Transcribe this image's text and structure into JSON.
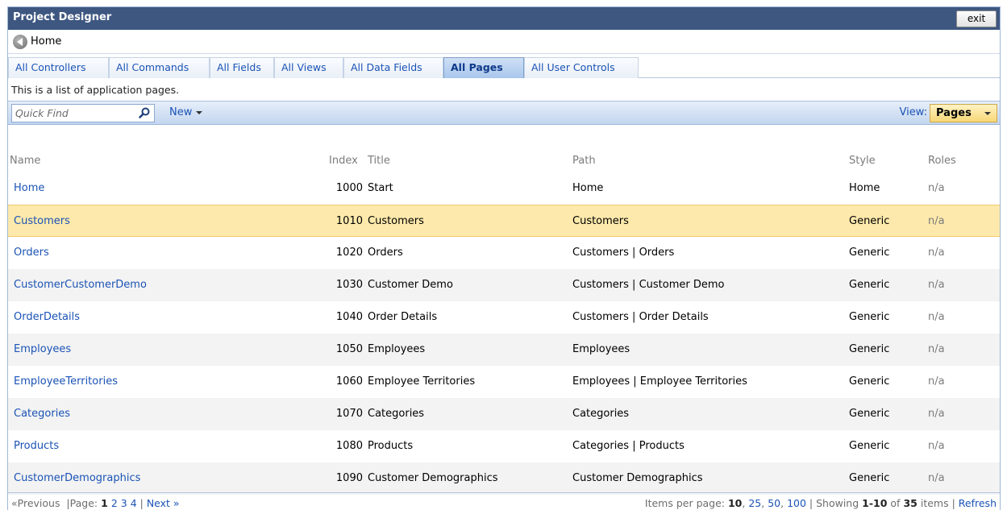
{
  "window": {
    "title": "Project Designer",
    "exit_label": "exit"
  },
  "nav": {
    "home_label": "Home"
  },
  "tabs": [
    {
      "label": "All Controllers"
    },
    {
      "label": "All Commands"
    },
    {
      "label": "All Fields"
    },
    {
      "label": "All Views"
    },
    {
      "label": "All Data Fields"
    },
    {
      "label": "All Pages",
      "active": true
    },
    {
      "label": "All User Controls"
    }
  ],
  "description": "This is a list of application pages.",
  "toolbar": {
    "quick_find_placeholder": "Quick Find",
    "new_label": "New",
    "view_label": "View:",
    "view_value": "Pages"
  },
  "grid": {
    "columns": {
      "name": "Name",
      "index": "Index",
      "title": "Title",
      "path": "Path",
      "style": "Style",
      "roles": "Roles"
    },
    "rows": [
      {
        "name": "Home",
        "index": "1000",
        "title": "Start",
        "path": "Home",
        "style": "Home",
        "roles": "n/a"
      },
      {
        "name": "Customers",
        "index": "1010",
        "title": "Customers",
        "path": "Customers",
        "style": "Generic",
        "roles": "n/a",
        "selected": true
      },
      {
        "name": "Orders",
        "index": "1020",
        "title": "Orders",
        "path": "Customers | Orders",
        "style": "Generic",
        "roles": "n/a"
      },
      {
        "name": "CustomerCustomerDemo",
        "index": "1030",
        "title": "Customer Demo",
        "path": "Customers | Customer Demo",
        "style": "Generic",
        "roles": "n/a"
      },
      {
        "name": "OrderDetails",
        "index": "1040",
        "title": "Order Details",
        "path": "Customers | Order Details",
        "style": "Generic",
        "roles": "n/a"
      },
      {
        "name": "Employees",
        "index": "1050",
        "title": "Employees",
        "path": "Employees",
        "style": "Generic",
        "roles": "n/a"
      },
      {
        "name": "EmployeeTerritories",
        "index": "1060",
        "title": "Employee Territories",
        "path": "Employees | Employee Territories",
        "style": "Generic",
        "roles": "n/a"
      },
      {
        "name": "Categories",
        "index": "1070",
        "title": "Categories",
        "path": "Categories",
        "style": "Generic",
        "roles": "n/a"
      },
      {
        "name": "Products",
        "index": "1080",
        "title": "Products",
        "path": "Categories | Products",
        "style": "Generic",
        "roles": "n/a"
      },
      {
        "name": "CustomerDemographics",
        "index": "1090",
        "title": "Customer Demographics",
        "path": "Customer Demographics",
        "style": "Generic",
        "roles": "n/a"
      }
    ]
  },
  "pager": {
    "previous": "«Previous",
    "page_label": "Page:",
    "pages": [
      "1",
      "2",
      "3",
      "4"
    ],
    "next": "Next »",
    "items_per_page_label": "Items per page:",
    "page_sizes": [
      "10",
      "25",
      "50",
      "100"
    ],
    "showing_label": "Showing",
    "showing_range": "1-10",
    "of_label": "of",
    "total": "35",
    "items_label": "items",
    "refresh": "Refresh"
  },
  "colors": {
    "title_bar": "#3e5781",
    "link": "#1b53b5",
    "selected_row": "#fde9ab"
  },
  "icons": {
    "back": "back-arrow-icon",
    "search": "search-icon"
  }
}
